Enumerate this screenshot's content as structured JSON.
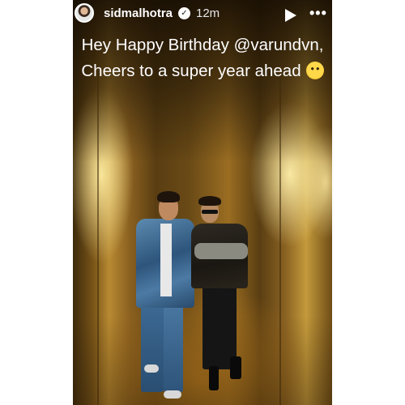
{
  "story": {
    "username": "sidmalhotra",
    "time_ago": "12m",
    "caption_line1": "Hey Happy Birthday @varundvn,",
    "caption_line2": "Cheers to a super year ahead",
    "icons": [
      "avatar",
      "verified-badge-icon",
      "play-icon",
      "more-icon",
      "hugging-face-emoji"
    ]
  }
}
